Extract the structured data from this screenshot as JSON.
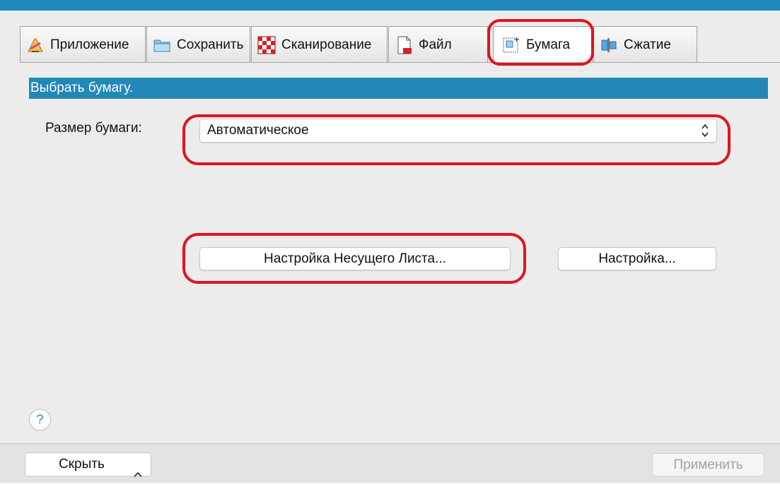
{
  "tabs": [
    {
      "label": "Приложение",
      "icon": "application-icon"
    },
    {
      "label": "Сохранить",
      "icon": "folder-icon"
    },
    {
      "label": "Сканирование",
      "icon": "scan-checker-icon"
    },
    {
      "label": "Файл",
      "icon": "file-icon"
    },
    {
      "label": "Бумага",
      "icon": "paper-icon",
      "selected": true
    },
    {
      "label": "Сжатие",
      "icon": "compression-icon"
    }
  ],
  "section": {
    "title": "Выбрать бумагу."
  },
  "paper": {
    "label": "Размер бумаги:",
    "selected_value": "Автоматическое"
  },
  "buttons": {
    "carrier_sheet": "Настройка Несущего Листа...",
    "settings": "Настройка...",
    "hide": "Скрыть",
    "apply": "Применить",
    "help": "?"
  },
  "colors": {
    "section_header": "#2288b8",
    "top_accent": "#1f89bb",
    "highlight_marker": "#e0141e"
  }
}
